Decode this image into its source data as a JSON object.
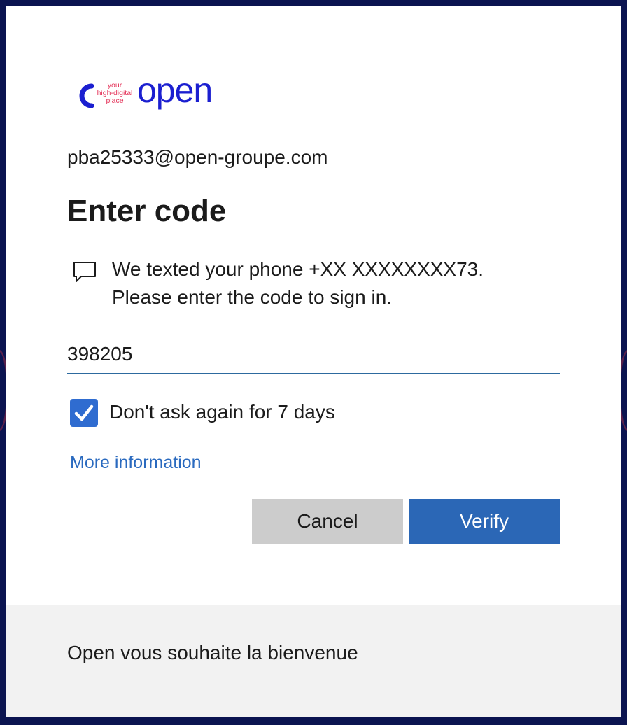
{
  "brand": {
    "logo_tagline_line1": "your",
    "logo_tagline_line2": "high-digital",
    "logo_tagline_line3": "place",
    "logo_wordmark": "open",
    "logo_color": "#1b1fd0",
    "tagline_color": "#e4345a"
  },
  "account": {
    "email": "pba25333@open-groupe.com"
  },
  "page": {
    "title": "Enter code",
    "message_line1": "We texted your phone +XX XXXXXXXX73.",
    "message_line2": "Please enter the code to sign in."
  },
  "form": {
    "code_value": "398205",
    "remember_checked": true,
    "remember_label": "Don't ask again for 7 days",
    "more_info_label": "More information"
  },
  "buttons": {
    "cancel_label": "Cancel",
    "verify_label": "Verify"
  },
  "footer": {
    "text": "Open vous souhaite la bienvenue"
  },
  "colors": {
    "accent": "#2b67b6",
    "link": "#2a6abf",
    "checkbox": "#2f6cd0",
    "page_background": "#0b1450"
  },
  "icons": {
    "message": "chat-bubble-icon",
    "checkbox": "checkmark-icon"
  }
}
